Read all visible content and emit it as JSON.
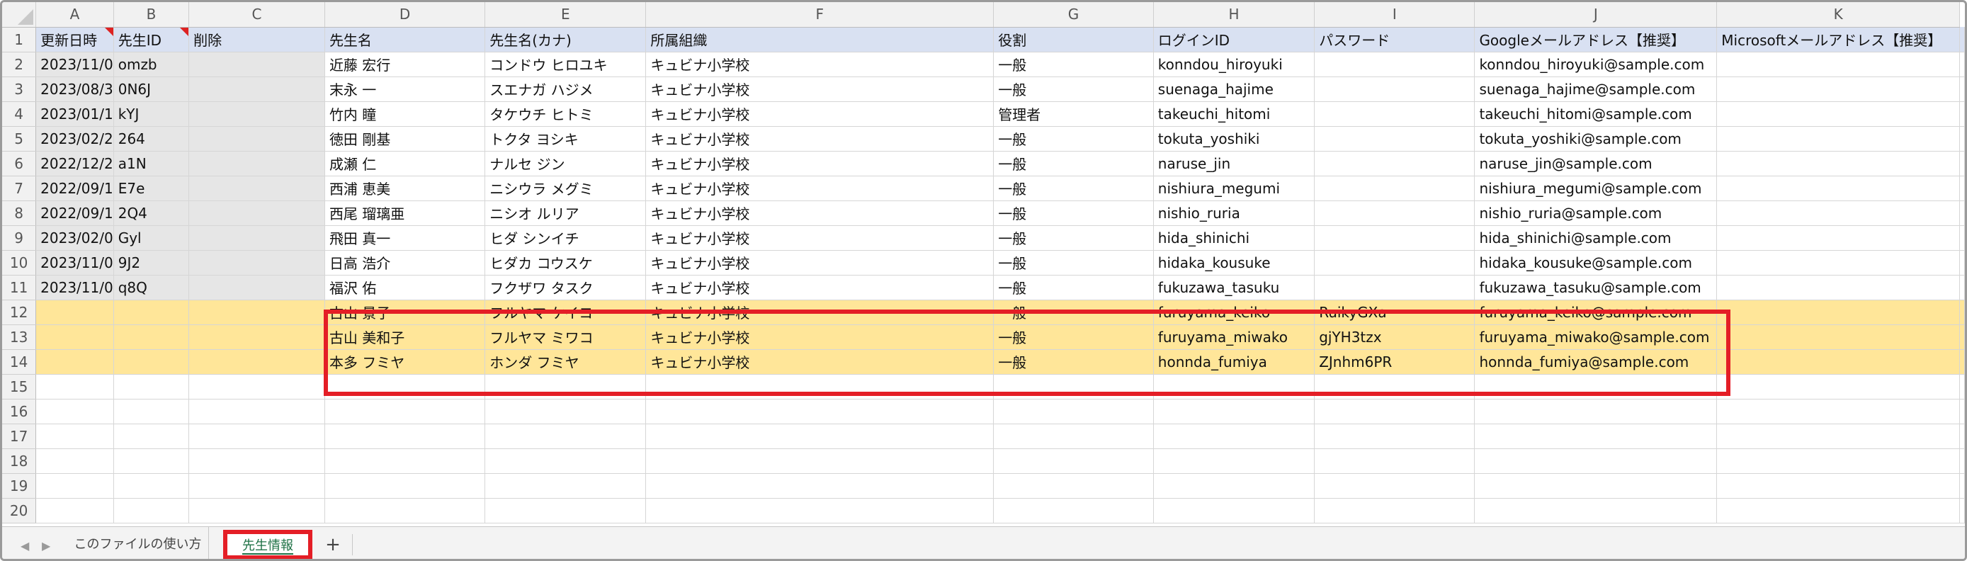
{
  "columns": [
    "A",
    "B",
    "C",
    "D",
    "E",
    "F",
    "G",
    "H",
    "I",
    "J",
    "K"
  ],
  "header_row": {
    "num": "1",
    "cells": [
      "更新日時",
      "先生ID",
      "削除",
      "先生名",
      "先生名(カナ)",
      "所属組織",
      "役割",
      "ログインID",
      "パスワード",
      "Googleメールアドレス【推奨】",
      "Microsoftメールアドレス【推奨】"
    ]
  },
  "rows": [
    {
      "num": "2",
      "cells": [
        "2023/11/0",
        "omzb",
        "",
        "近藤 宏行",
        "コンドウ ヒロユキ",
        "キュビナ小学校",
        "一般",
        "konndou_hiroyuki",
        "",
        "konndou_hiroyuki@sample.com",
        ""
      ]
    },
    {
      "num": "3",
      "cells": [
        "2023/08/3",
        "0N6J",
        "",
        "末永 一",
        "スエナガ ハジメ",
        "キュビナ小学校",
        "一般",
        "suenaga_hajime",
        "",
        "suenaga_hajime@sample.com",
        ""
      ]
    },
    {
      "num": "4",
      "cells": [
        "2023/01/1",
        "kYJ",
        "",
        "竹内 瞳",
        "タケウチ ヒトミ",
        "キュビナ小学校",
        "管理者",
        "takeuchi_hitomi",
        "",
        "takeuchi_hitomi@sample.com",
        ""
      ]
    },
    {
      "num": "5",
      "cells": [
        "2023/02/2",
        "264",
        "",
        "徳田 剛基",
        "トクタ ヨシキ",
        "キュビナ小学校",
        "一般",
        "tokuta_yoshiki",
        "",
        "tokuta_yoshiki@sample.com",
        ""
      ]
    },
    {
      "num": "6",
      "cells": [
        "2022/12/2",
        "a1N",
        "",
        "成瀬 仁",
        "ナルセ ジン",
        "キュビナ小学校",
        "一般",
        "naruse_jin",
        "",
        "naruse_jin@sample.com",
        ""
      ]
    },
    {
      "num": "7",
      "cells": [
        "2022/09/1",
        "E7e",
        "",
        "西浦 恵美",
        "ニシウラ メグミ",
        "キュビナ小学校",
        "一般",
        "nishiura_megumi",
        "",
        "nishiura_megumi@sample.com",
        ""
      ]
    },
    {
      "num": "8",
      "cells": [
        "2022/09/1",
        "2Q4",
        "",
        "西尾 瑠璃亜",
        "ニシオ ルリア",
        "キュビナ小学校",
        "一般",
        "nishio_ruria",
        "",
        "nishio_ruria@sample.com",
        ""
      ]
    },
    {
      "num": "9",
      "cells": [
        "2023/02/0",
        "Gyl",
        "",
        "飛田 真一",
        "ヒダ シンイチ",
        "キュビナ小学校",
        "一般",
        "hida_shinichi",
        "",
        "hida_shinichi@sample.com",
        ""
      ]
    },
    {
      "num": "10",
      "cells": [
        "2023/11/0",
        "9J2",
        "",
        "日高 浩介",
        "ヒダカ コウスケ",
        "キュビナ小学校",
        "一般",
        "hidaka_kousuke",
        "",
        "hidaka_kousuke@sample.com",
        ""
      ]
    },
    {
      "num": "11",
      "cells": [
        "2023/11/0",
        "q8Q",
        "",
        "福沢 佑",
        "フクザワ タスク",
        "キュビナ小学校",
        "一般",
        "fukuzawa_tasuku",
        "",
        "fukuzawa_tasuku@sample.com",
        ""
      ]
    },
    {
      "num": "12",
      "cells": [
        "",
        "",
        "",
        "古山 景子",
        "フルヤマ ケイコ",
        "キュビナ小学校",
        "一般",
        "furuyama_keiko",
        "RuikyGXa",
        "furuyama_keiko@sample.com",
        ""
      ]
    },
    {
      "num": "13",
      "cells": [
        "",
        "",
        "",
        "古山 美和子",
        "フルヤマ ミワコ",
        "キュビナ小学校",
        "一般",
        "furuyama_miwako",
        "gjYH3tzx",
        "furuyama_miwako@sample.com",
        ""
      ]
    },
    {
      "num": "14",
      "cells": [
        "",
        "",
        "",
        "本多 フミヤ",
        "ホンダ フミヤ",
        "キュビナ小学校",
        "一般",
        "honnda_fumiya",
        "ZJnhm6PR",
        "honnda_fumiya@sample.com",
        ""
      ]
    },
    {
      "num": "15",
      "cells": [
        "",
        "",
        "",
        "",
        "",
        "",
        "",
        "",
        "",
        "",
        ""
      ]
    },
    {
      "num": "16",
      "cells": [
        "",
        "",
        "",
        "",
        "",
        "",
        "",
        "",
        "",
        "",
        ""
      ]
    },
    {
      "num": "17",
      "cells": [
        "",
        "",
        "",
        "",
        "",
        "",
        "",
        "",
        "",
        "",
        ""
      ]
    },
    {
      "num": "18",
      "cells": [
        "",
        "",
        "",
        "",
        "",
        "",
        "",
        "",
        "",
        "",
        ""
      ]
    },
    {
      "num": "19",
      "cells": [
        "",
        "",
        "",
        "",
        "",
        "",
        "",
        "",
        "",
        "",
        ""
      ]
    },
    {
      "num": "20",
      "cells": [
        "",
        "",
        "",
        "",
        "",
        "",
        "",
        "",
        "",
        "",
        ""
      ]
    }
  ],
  "highlighted_rows": [
    "12",
    "13",
    "14"
  ],
  "sheet_tabs": {
    "nav_prev": "◀",
    "nav_next": "▶",
    "inactive_tab": "このファイルの使い方",
    "active_tab": "先生情報",
    "add_sheet": "+"
  },
  "colors": {
    "header_fill": "#d9e1f2",
    "highlight_fill": "#ffe699",
    "annotation_red": "#e41e26",
    "gray_fill": "#e6e6e6",
    "active_tab_text": "#1e7145"
  }
}
